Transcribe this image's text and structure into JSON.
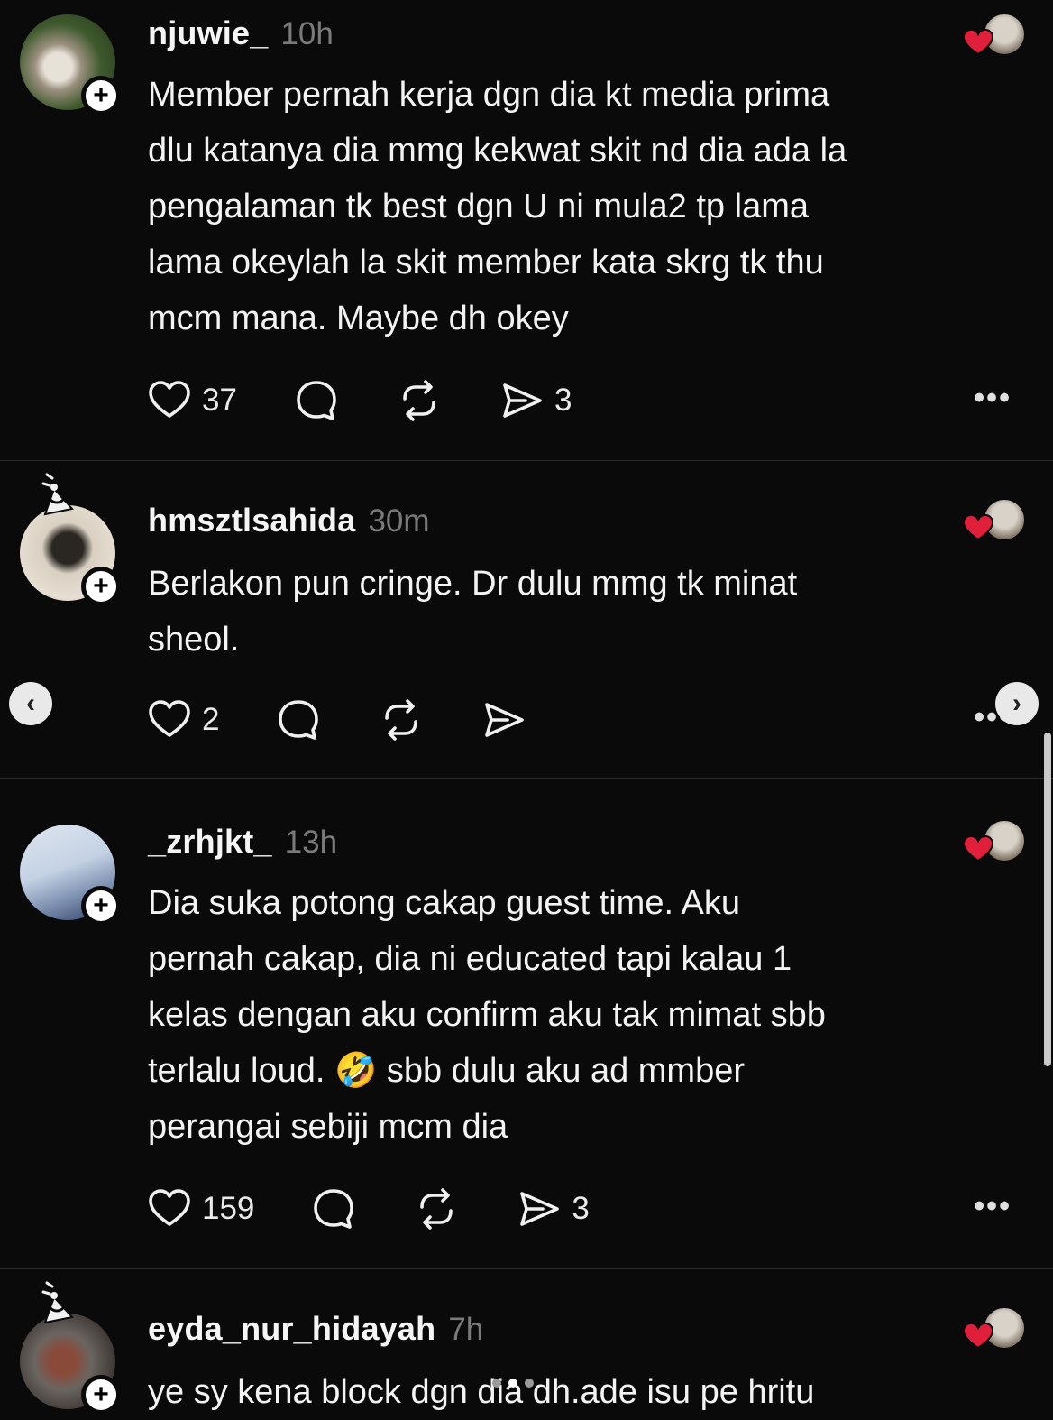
{
  "posts": [
    {
      "username": "njuwie_",
      "time": "10h",
      "text": "Member pernah kerja dgn dia kt media prima\ndlu katanya dia mmg kekwat skit nd dia ada la\npengalaman tk best dgn U ni mula2 tp lama\nlama okeylah la skit member kata skrg tk thu\nmcm mana. Maybe dh okey",
      "likes": "37",
      "replies": "",
      "reposts": "",
      "shares": "3"
    },
    {
      "username": "hmsztlsahida",
      "time": "30m",
      "text": "Berlakon pun cringe. Dr dulu mmg tk minat\nsheol.",
      "likes": "2",
      "replies": "",
      "reposts": "",
      "shares": ""
    },
    {
      "username": "_zrhjkt_",
      "time": "13h",
      "text": "Dia suka potong cakap guest time. Aku\npernah cakap, dia ni educated tapi kalau 1\nkelas dengan aku confirm aku tak mimat sbb\nterlalu loud. 🤣 sbb dulu aku ad mmber\nperangai sebiji mcm dia",
      "likes": "159",
      "replies": "",
      "reposts": "",
      "shares": "3"
    },
    {
      "username": "eyda_nur_hidayah",
      "time": "7h",
      "text": "ye sy kena block dgn dia dh.ade isu pe hritu",
      "likes": "",
      "replies": "",
      "reposts": "",
      "shares": ""
    }
  ],
  "ui": {
    "more_label": "•••",
    "follow_symbol": "+",
    "prev_symbol": "‹",
    "next_symbol": "›"
  },
  "colors": {
    "background": "#0a0a0a",
    "text": "#f3f3f3",
    "muted": "#7a7a7a",
    "heart": "#e0203a"
  }
}
